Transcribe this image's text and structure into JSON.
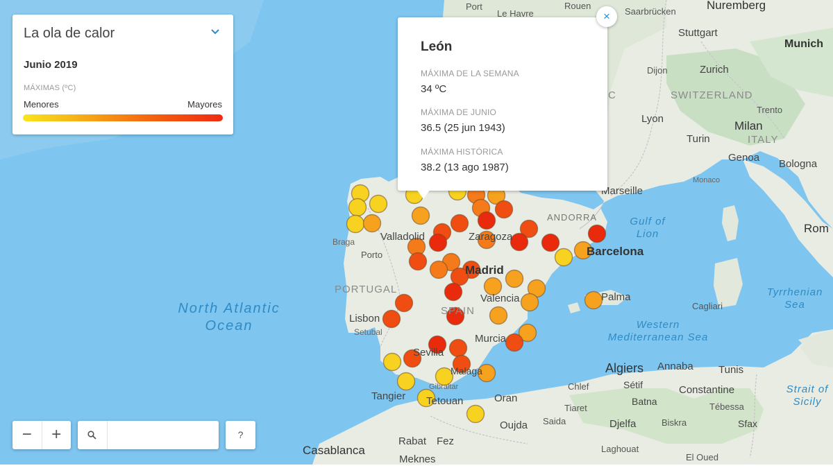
{
  "legend": {
    "title": "La ola de calor",
    "period": "Junio 2019",
    "subtitle": "MÁXIMAS (ºC)",
    "min_label": "Menores",
    "max_label": "Mayores",
    "icon": "chevron-down-icon",
    "scale_colors": [
      "#f8e51c",
      "#f6a516",
      "#f35e0f",
      "#ef2a10"
    ]
  },
  "popup": {
    "title": "León",
    "fields": [
      {
        "label": "MÁXIMA DE LA SEMANA",
        "value": "34 ºC"
      },
      {
        "label": "MÁXIMA DE JUNIO",
        "value": "36.5 (25 jun 1943)"
      },
      {
        "label": "MÁXIMA HISTÓRICA",
        "value": "38.2 (13 ago 1987)"
      }
    ],
    "close_label": "×"
  },
  "controls": {
    "zoom_out_label": "−",
    "zoom_in_label": "+",
    "search_placeholder": "",
    "search_value": "",
    "help_label": "?",
    "search_icon": "search-icon"
  },
  "basemap": {
    "labels": [
      "Port",
      "Le Havre",
      "Rouen",
      "Saarbrücken",
      "Nuremberg",
      "Stuttgart",
      "Munich",
      "Dijon",
      "Zurich",
      "SWITZERLAND",
      "Lyon",
      "Trento",
      "Turin",
      "Milan",
      "ITALY",
      "Genoa",
      "Bologna",
      "Monaco",
      "Marseille",
      "ANDORRA",
      "Gulf of Lion",
      "Barcelona",
      "Valladolid",
      "Zaragoza",
      "Braga",
      "Porto",
      "Madrid",
      "PORTUGAL",
      "SPAIN",
      "Valencia",
      "Palma",
      "Cagliari",
      "Tyrrhenian Sea",
      "North Atlantic Ocean",
      "Lisbon",
      "Setubal",
      "Murcia",
      "Western Mediterranean Sea",
      "Sevilla",
      "Malaga",
      "Gibraltar",
      "Tangier",
      "Tetouan",
      "Oran",
      "Algiers",
      "Annaba",
      "Tunis",
      "Strait of Sicily",
      "Chlef",
      "Sétif",
      "Constantine",
      "Batna",
      "Tébessa",
      "Tiaret",
      "Djelfa",
      "Biskra",
      "Sfax",
      "Saida",
      "Oujda",
      "Rabat",
      "Fez",
      "Casablanca",
      "Meknes",
      "Laghouat",
      "El Oued",
      "Rom",
      "C"
    ]
  },
  "stations": {
    "count": 71,
    "colors": {
      "yellow": "#f8d220",
      "orange_light": "#f6a21e",
      "orange": "#f47a1a",
      "red_orange": "#f04d12",
      "red": "#ea2a0c"
    }
  }
}
